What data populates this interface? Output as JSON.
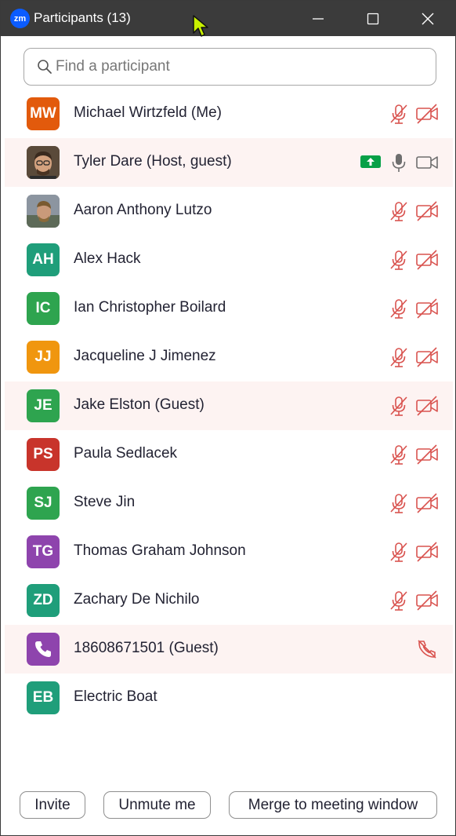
{
  "titlebar": {
    "app_logo": "zm",
    "title": "Participants (13)"
  },
  "search": {
    "placeholder": "Find a participant",
    "value": ""
  },
  "colors": {
    "muted_red": "#d9534f",
    "share_green": "#07a047",
    "row_highlight": "#fdf3f2"
  },
  "participants": [
    {
      "name": "Michael Wirtzfeld (Me)",
      "initials": "MW",
      "avatar_color": "#e25a0c",
      "avatar_type": "initials",
      "mic": "muted",
      "video": "off",
      "highlight": false
    },
    {
      "name": "Tyler Dare (Host, guest)",
      "initials": "",
      "avatar_color": "#6b5a4a",
      "avatar_type": "photo",
      "mic": "on",
      "video": "on",
      "sharing": true,
      "highlight": true
    },
    {
      "name": "Aaron Anthony Lutzo",
      "initials": "",
      "avatar_color": "#7a8088",
      "avatar_type": "photo",
      "mic": "muted",
      "video": "off",
      "highlight": false
    },
    {
      "name": "Alex Hack",
      "initials": "AH",
      "avatar_color": "#1f9e7a",
      "avatar_type": "initials",
      "mic": "muted",
      "video": "off",
      "highlight": false
    },
    {
      "name": "Ian Christopher Boilard",
      "initials": "IC",
      "avatar_color": "#2ea44f",
      "avatar_type": "initials",
      "mic": "muted",
      "video": "off",
      "highlight": false
    },
    {
      "name": "Jacqueline J Jimenez",
      "initials": "JJ",
      "avatar_color": "#f0960f",
      "avatar_type": "initials",
      "mic": "muted",
      "video": "off",
      "highlight": false
    },
    {
      "name": "Jake Elston (Guest)",
      "initials": "JE",
      "avatar_color": "#2ea44f",
      "avatar_type": "initials",
      "mic": "muted",
      "video": "off",
      "highlight": true
    },
    {
      "name": "Paula Sedlacek",
      "initials": "PS",
      "avatar_color": "#c8342b",
      "avatar_type": "initials",
      "mic": "muted",
      "video": "off",
      "highlight": false
    },
    {
      "name": "Steve Jin",
      "initials": "SJ",
      "avatar_color": "#2ea44f",
      "avatar_type": "initials",
      "mic": "muted",
      "video": "off",
      "highlight": false
    },
    {
      "name": "Thomas Graham Johnson",
      "initials": "TG",
      "avatar_color": "#8e44ad",
      "avatar_type": "initials",
      "mic": "muted",
      "video": "off",
      "highlight": false
    },
    {
      "name": "Zachary De Nichilo",
      "initials": "ZD",
      "avatar_color": "#1f9e7a",
      "avatar_type": "initials",
      "mic": "muted",
      "video": "off",
      "highlight": false
    },
    {
      "name": "18608671501 (Guest)",
      "initials": "",
      "avatar_color": "#8e44ad",
      "avatar_type": "phone",
      "mic": "phone-muted",
      "video": "none",
      "highlight": true
    },
    {
      "name": "Electric Boat",
      "initials": "EB",
      "avatar_color": "#1f9e7a",
      "avatar_type": "initials",
      "mic": "none",
      "video": "none",
      "highlight": false
    }
  ],
  "footer": {
    "invite_label": "Invite",
    "unmute_label": "Unmute me",
    "merge_label": "Merge to meeting window"
  }
}
